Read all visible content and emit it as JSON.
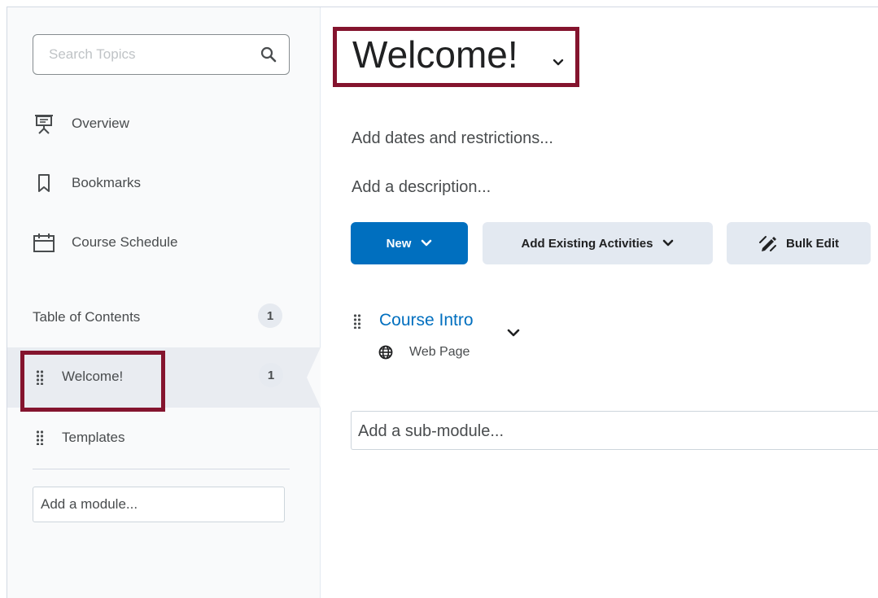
{
  "sidebar": {
    "search_placeholder": "Search Topics",
    "nav_items": [
      {
        "label": "Overview",
        "icon": "presentation-icon"
      },
      {
        "label": "Bookmarks",
        "icon": "bookmark-icon"
      },
      {
        "label": "Course Schedule",
        "icon": "calendar-icon"
      }
    ],
    "toc_label": "Table of Contents",
    "toc_count": "1",
    "modules": [
      {
        "label": "Welcome!",
        "count": "1",
        "selected": true
      },
      {
        "label": "Templates"
      }
    ],
    "add_module_placeholder": "Add a module..."
  },
  "main": {
    "title": "Welcome!",
    "dates_placeholder": "Add dates and restrictions...",
    "description_placeholder": "Add a description...",
    "buttons": {
      "new": "New",
      "add_existing": "Add Existing Activities",
      "bulk_edit": "Bulk Edit"
    },
    "topic": {
      "title": "Course Intro",
      "type": "Web Page"
    },
    "submodule_placeholder": "Add a sub-module..."
  },
  "colors": {
    "primary_blue": "#006fbf",
    "highlight": "#84142e",
    "button_grey": "#e3e9f1"
  }
}
